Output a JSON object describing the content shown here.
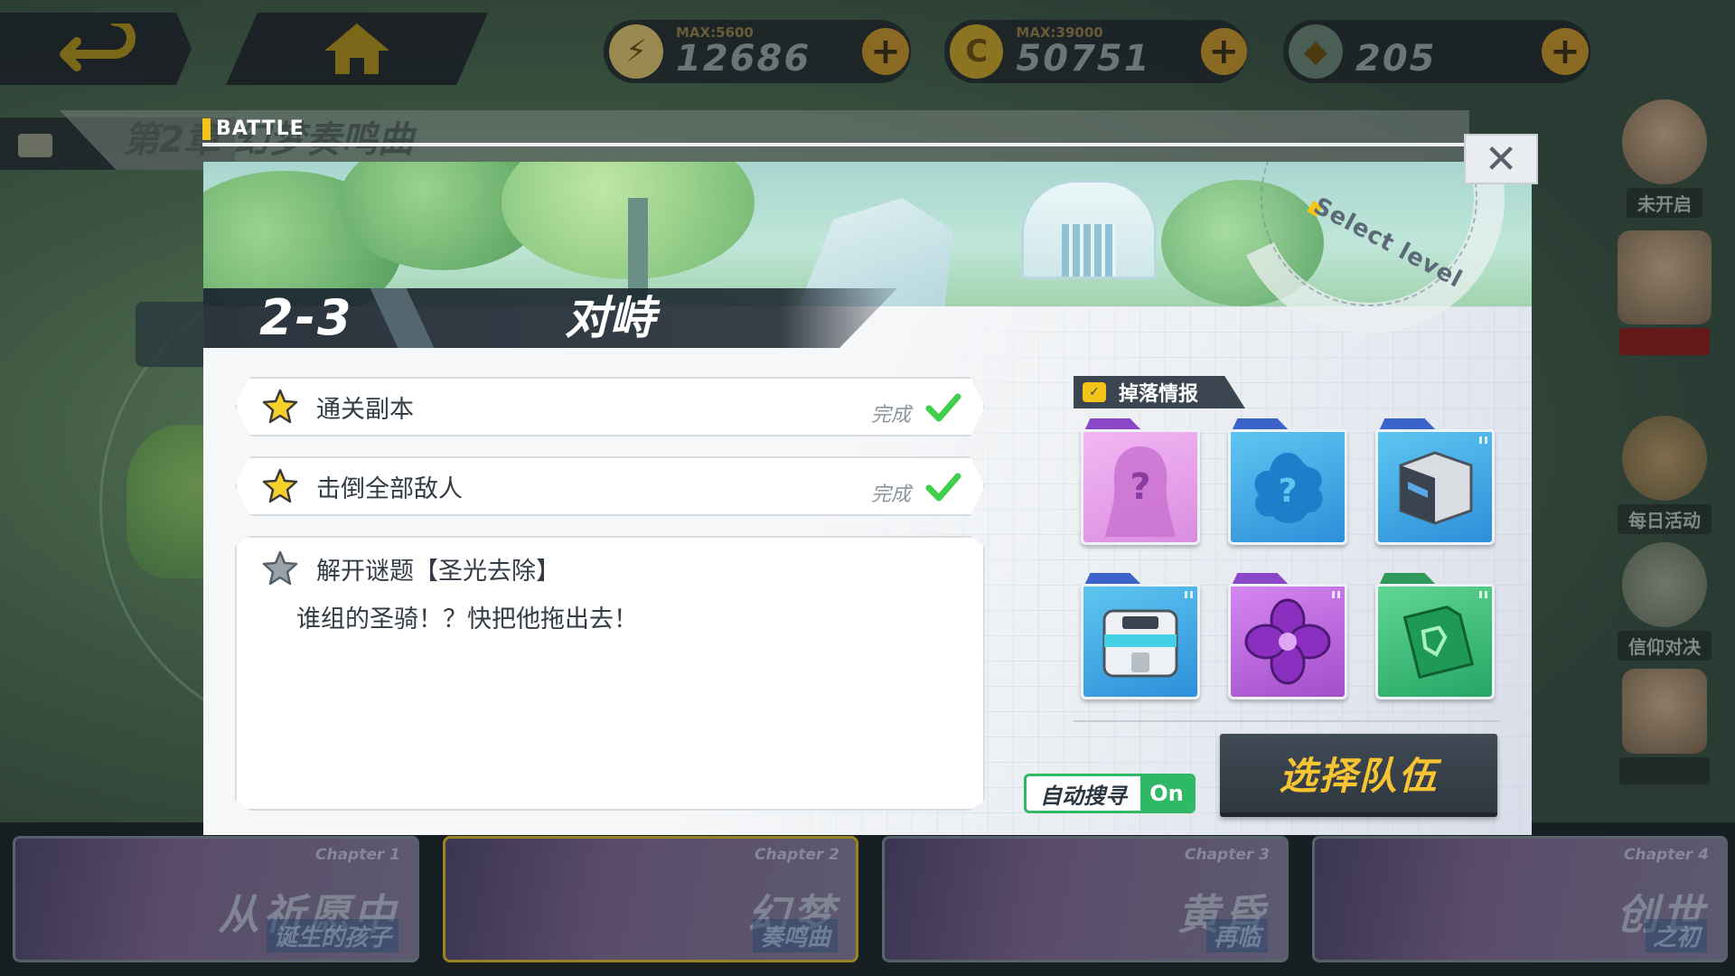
{
  "topbar": {
    "resources": [
      {
        "icon": "energy-card-icon",
        "max_label": "MAX:5600",
        "value": "12686"
      },
      {
        "icon": "gold-coin-icon",
        "max_label": "MAX:39000",
        "value": "50751"
      },
      {
        "icon": "gem-icon",
        "max_label": "",
        "value": "205"
      }
    ]
  },
  "chapter_header": {
    "title": "第2章 幻梦奏鸣曲"
  },
  "side_events": [
    {
      "label": "未开启"
    },
    {
      "label": ""
    },
    {
      "label": "每日活动"
    },
    {
      "label": "信仰对决"
    },
    {
      "label": ""
    }
  ],
  "chapters": [
    {
      "no": "Chapter 1",
      "name": "从祈愿中",
      "sub": "诞生的孩子"
    },
    {
      "no": "Chapter 2",
      "name": "幻梦",
      "sub": "奏鸣曲"
    },
    {
      "no": "Chapter 3",
      "name": "黄昏",
      "sub": "再临"
    },
    {
      "no": "Chapter 4",
      "name": "创世",
      "sub": "之初"
    }
  ],
  "modal": {
    "battle_label": "BATTLE",
    "close_glyph": "✕",
    "select_level": "Select level",
    "level_no": "2-3",
    "level_name": "对峙",
    "objectives": [
      {
        "text": "通关副本",
        "status": "完成",
        "completed": true
      },
      {
        "text": "击倒全部敌人",
        "status": "完成",
        "completed": true
      }
    ],
    "puzzle": {
      "title": "解开谜题【圣光去除】",
      "description": "谁组的圣骑！？快把他拖出去！",
      "completed": false
    },
    "drop_info": {
      "label": "掉落情报",
      "items": [
        {
          "icon": "unknown-character-icon",
          "rarity_color": "#8a47c8",
          "glyph": "?"
        },
        {
          "icon": "unknown-material-icon",
          "rarity_color": "#3b63c9",
          "glyph": "?"
        },
        {
          "icon": "armor-chest-icon",
          "rarity_color": "#3b63c9",
          "glyph": ""
        },
        {
          "icon": "supply-crate-icon",
          "rarity_color": "#3b63c9",
          "glyph": ""
        },
        {
          "icon": "purple-crystal-icon",
          "rarity_color": "#8a47c8",
          "glyph": ""
        },
        {
          "icon": "green-chip-icon",
          "rarity_color": "#2f9a5c",
          "glyph": ""
        }
      ]
    },
    "auto_search": {
      "label": "自动搜寻",
      "state": "On"
    },
    "select_team_button": "选择队伍"
  }
}
